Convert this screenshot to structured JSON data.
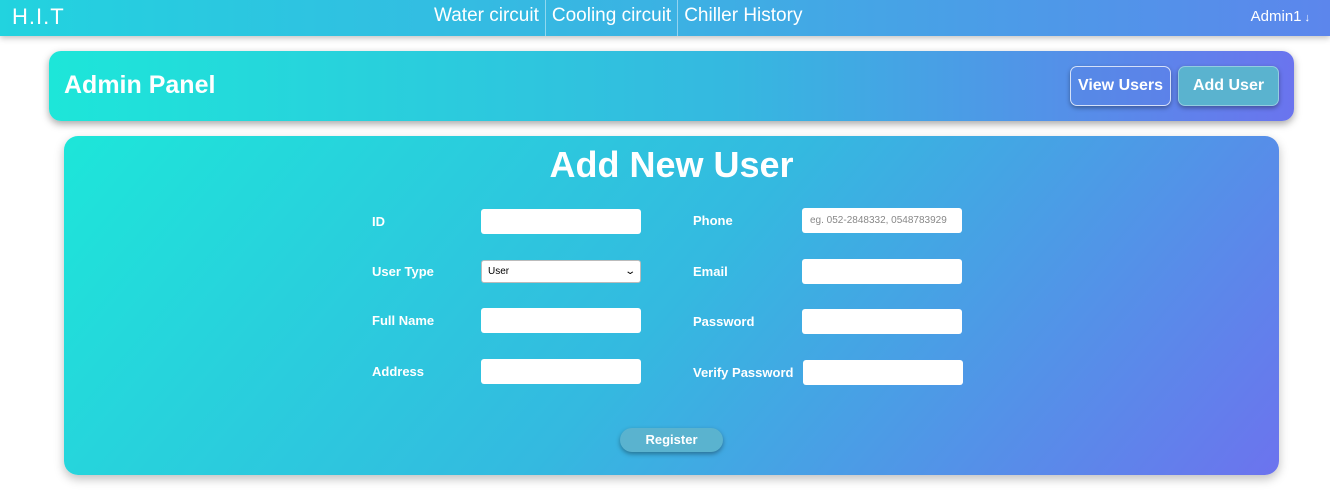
{
  "navbar": {
    "brand": "H.I.T",
    "links": [
      "Water circuit",
      "Cooling circuit",
      "Chiller History"
    ],
    "user": "Admin1",
    "user_arrow": "↓"
  },
  "admin_panel": {
    "title": "Admin Panel",
    "view_users": "View Users",
    "add_user": "Add User"
  },
  "form": {
    "title": "Add New User",
    "id_label": "ID",
    "id_value": "",
    "user_type_label": "User Type",
    "user_type_value": "User",
    "full_name_label": "Full Name",
    "full_name_value": "",
    "address_label": "Address",
    "address_value": "",
    "phone_label": "Phone",
    "phone_placeholder": "eg. 052-2848332, 0548783929",
    "email_label": "Email",
    "email_value": "",
    "password_label": "Password",
    "verify_password_label": "Verify Password",
    "register": "Register"
  },
  "colors": {
    "gradient_start": "#1de6d9",
    "gradient_mid": "#35b8e0",
    "gradient_end": "#6a74ee",
    "button": "#5ab3cf"
  }
}
